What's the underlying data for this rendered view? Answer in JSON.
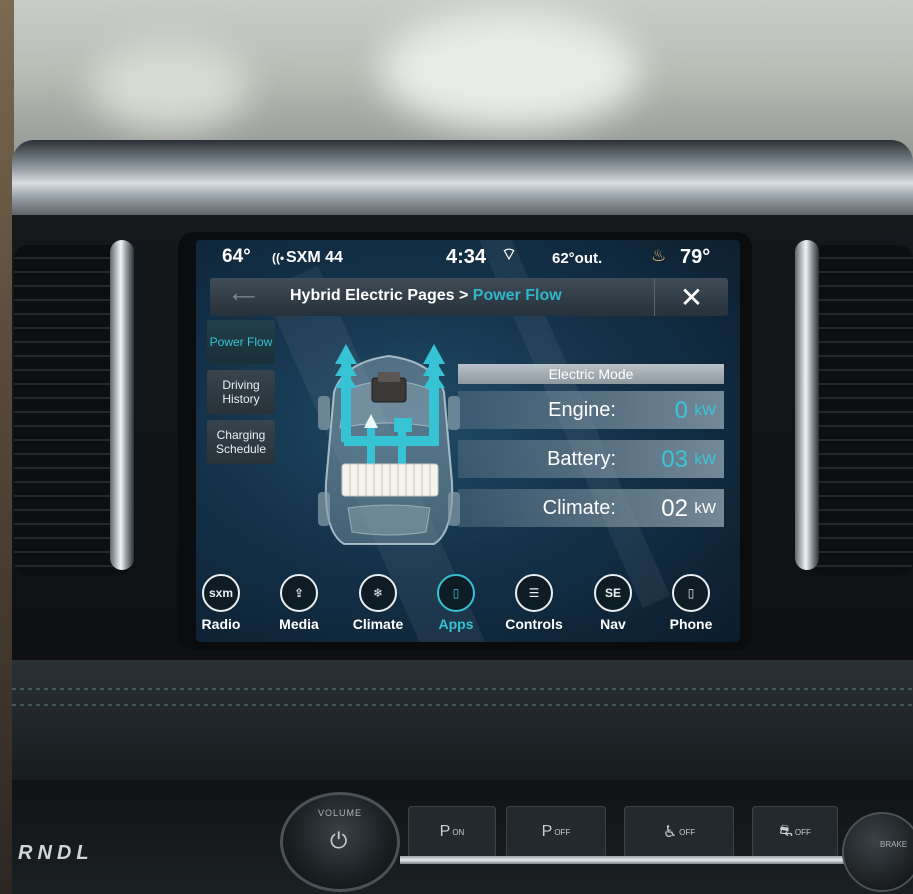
{
  "status_bar": {
    "inside_temp_left": "64°",
    "radio_station": "SXM 44",
    "time": "4:34",
    "outside_temp": "62°out.",
    "inside_temp_right": "79°"
  },
  "header": {
    "breadcrumb_root": "Hybrid Electric Pages",
    "breadcrumb_separator": ">",
    "breadcrumb_current": "Power Flow",
    "close_symbol": "✕"
  },
  "side_tabs": [
    {
      "label": "Power Flow",
      "active": true
    },
    {
      "label": "Driving History",
      "active": false
    },
    {
      "label": "Charging Schedule",
      "active": false
    }
  ],
  "power_flow": {
    "mode": "Electric Mode",
    "readouts": [
      {
        "label": "Engine:",
        "value": "0",
        "unit": "kW"
      },
      {
        "label": "Battery:",
        "value": "03",
        "unit": "kW"
      },
      {
        "label": "Climate:",
        "value": "02",
        "unit": "kW"
      }
    ]
  },
  "bottom_nav": [
    {
      "label": "Radio",
      "icon": "radio-icon",
      "glyph": "sxm",
      "active": false
    },
    {
      "label": "Media",
      "icon": "usb-icon",
      "glyph": "⇪",
      "active": false
    },
    {
      "label": "Climate",
      "icon": "climate-icon",
      "glyph": "❄",
      "active": false
    },
    {
      "label": "Apps",
      "icon": "apps-icon",
      "glyph": "▯",
      "active": true
    },
    {
      "label": "Controls",
      "icon": "controls-icon",
      "glyph": "☰",
      "active": false
    },
    {
      "label": "Nav",
      "icon": "compass-icon",
      "glyph": "SE",
      "active": false
    },
    {
      "label": "Phone",
      "icon": "phone-icon",
      "glyph": "▯",
      "active": false
    }
  ],
  "console": {
    "gear_letters": "RNDL",
    "volume_label": "VOLUME",
    "power_symbol": "⏻",
    "buttons": [
      {
        "main": "P",
        "sub": "ON"
      },
      {
        "main": "P",
        "sub": "OFF"
      },
      {
        "main": "♿",
        "sub": "OFF"
      },
      {
        "main": "⛐",
        "sub": "OFF"
      }
    ],
    "brake_label": "BRAKE"
  },
  "colors": {
    "accent": "#35c2d4",
    "screen_background": "#14324a",
    "seat_heat_icon": "#f1c26a"
  }
}
